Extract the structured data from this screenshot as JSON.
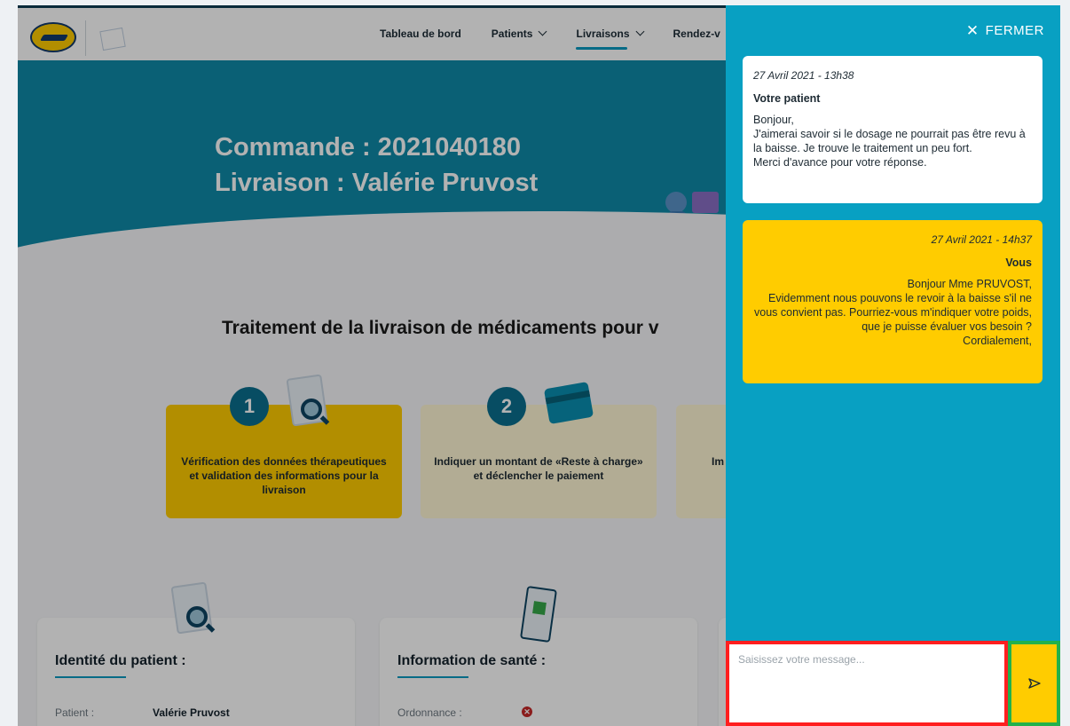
{
  "nav": {
    "items": [
      {
        "label": "Tableau de bord",
        "dropdown": false,
        "active": false
      },
      {
        "label": "Patients",
        "dropdown": true,
        "active": false
      },
      {
        "label": "Livraisons",
        "dropdown": true,
        "active": true
      },
      {
        "label": "Rendez-v",
        "dropdown": false,
        "active": false
      }
    ]
  },
  "hero": {
    "line1": "Commande : 2021040180",
    "line2": "Livraison : Valérie Pruvost"
  },
  "section": {
    "title": "Traitement de la livraison de médicaments pour v"
  },
  "steps": [
    {
      "num": "1",
      "text": "Vérification des données thérapeutiques et validation des informations pour la livraison"
    },
    {
      "num": "2",
      "text": "Indiquer un montant de «Reste à charge» et déclencher le paiement"
    },
    {
      "num": "",
      "text": "Im"
    }
  ],
  "cards": [
    {
      "title": "Identité du patient :",
      "row_label": "Patient :",
      "row_value": "Valérie Pruvost"
    },
    {
      "title": "Information de santé :",
      "row_label": "Ordonnance :",
      "row_value": ""
    }
  ],
  "chat": {
    "close_label": "FERMER",
    "messages": [
      {
        "date": "27 Avril 2021 - 13h38",
        "author": "Votre patient",
        "body": "Bonjour,\nJ'aimerai savoir si le dosage ne pourrait pas être revu à la baisse. Je trouve le traitement un peu fort.\nMerci d'avance pour votre réponse."
      },
      {
        "date": "27 Avril 2021 - 14h37",
        "author": "Vous",
        "body": "Bonjour Mme PRUVOST,\nEvidemment nous pouvons le revoir à la baisse s'il ne vous convient pas. Pourriez-vous m'indiquer votre poids, que je puisse évaluer vos besoin ?\nCordialement,"
      }
    ],
    "input_placeholder": "Saisissez votre message...",
    "input_value": ""
  },
  "colors": {
    "accent": "#08a0c2",
    "yellow": "#ffcc00",
    "input_highlight": "#ff1f1f",
    "send_highlight": "#22b14c"
  }
}
